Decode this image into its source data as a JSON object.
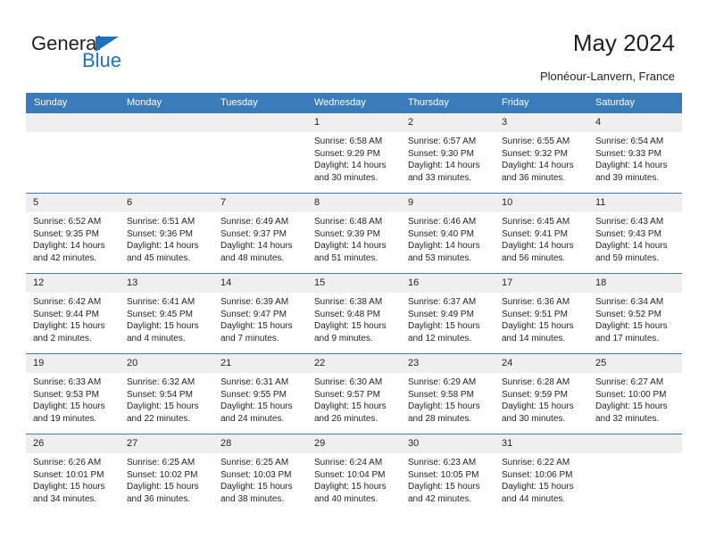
{
  "brand": {
    "name_part1": "General",
    "name_part2": "Blue",
    "color_dark": "#231f20",
    "color_blue": "#1c72bd"
  },
  "header": {
    "title": "May 2024",
    "subtitle": "Plonéour-Lanvern, France"
  },
  "calendar": {
    "header_bg": "#3a7cba",
    "daynum_bg": "#efefef",
    "weekdays": [
      "Sunday",
      "Monday",
      "Tuesday",
      "Wednesday",
      "Thursday",
      "Friday",
      "Saturday"
    ],
    "labels": {
      "sunrise": "Sunrise:",
      "sunset": "Sunset:",
      "daylight": "Daylight:"
    },
    "weeks": [
      [
        {
          "day": "",
          "sunrise": "",
          "sunset": "",
          "daylight_l1": "",
          "daylight_l2": ""
        },
        {
          "day": "",
          "sunrise": "",
          "sunset": "",
          "daylight_l1": "",
          "daylight_l2": ""
        },
        {
          "day": "",
          "sunrise": "",
          "sunset": "",
          "daylight_l1": "",
          "daylight_l2": ""
        },
        {
          "day": "1",
          "sunrise": "Sunrise: 6:58 AM",
          "sunset": "Sunset: 9:29 PM",
          "daylight_l1": "Daylight: 14 hours",
          "daylight_l2": "and 30 minutes."
        },
        {
          "day": "2",
          "sunrise": "Sunrise: 6:57 AM",
          "sunset": "Sunset: 9:30 PM",
          "daylight_l1": "Daylight: 14 hours",
          "daylight_l2": "and 33 minutes."
        },
        {
          "day": "3",
          "sunrise": "Sunrise: 6:55 AM",
          "sunset": "Sunset: 9:32 PM",
          "daylight_l1": "Daylight: 14 hours",
          "daylight_l2": "and 36 minutes."
        },
        {
          "day": "4",
          "sunrise": "Sunrise: 6:54 AM",
          "sunset": "Sunset: 9:33 PM",
          "daylight_l1": "Daylight: 14 hours",
          "daylight_l2": "and 39 minutes."
        }
      ],
      [
        {
          "day": "5",
          "sunrise": "Sunrise: 6:52 AM",
          "sunset": "Sunset: 9:35 PM",
          "daylight_l1": "Daylight: 14 hours",
          "daylight_l2": "and 42 minutes."
        },
        {
          "day": "6",
          "sunrise": "Sunrise: 6:51 AM",
          "sunset": "Sunset: 9:36 PM",
          "daylight_l1": "Daylight: 14 hours",
          "daylight_l2": "and 45 minutes."
        },
        {
          "day": "7",
          "sunrise": "Sunrise: 6:49 AM",
          "sunset": "Sunset: 9:37 PM",
          "daylight_l1": "Daylight: 14 hours",
          "daylight_l2": "and 48 minutes."
        },
        {
          "day": "8",
          "sunrise": "Sunrise: 6:48 AM",
          "sunset": "Sunset: 9:39 PM",
          "daylight_l1": "Daylight: 14 hours",
          "daylight_l2": "and 51 minutes."
        },
        {
          "day": "9",
          "sunrise": "Sunrise: 6:46 AM",
          "sunset": "Sunset: 9:40 PM",
          "daylight_l1": "Daylight: 14 hours",
          "daylight_l2": "and 53 minutes."
        },
        {
          "day": "10",
          "sunrise": "Sunrise: 6:45 AM",
          "sunset": "Sunset: 9:41 PM",
          "daylight_l1": "Daylight: 14 hours",
          "daylight_l2": "and 56 minutes."
        },
        {
          "day": "11",
          "sunrise": "Sunrise: 6:43 AM",
          "sunset": "Sunset: 9:43 PM",
          "daylight_l1": "Daylight: 14 hours",
          "daylight_l2": "and 59 minutes."
        }
      ],
      [
        {
          "day": "12",
          "sunrise": "Sunrise: 6:42 AM",
          "sunset": "Sunset: 9:44 PM",
          "daylight_l1": "Daylight: 15 hours",
          "daylight_l2": "and 2 minutes."
        },
        {
          "day": "13",
          "sunrise": "Sunrise: 6:41 AM",
          "sunset": "Sunset: 9:45 PM",
          "daylight_l1": "Daylight: 15 hours",
          "daylight_l2": "and 4 minutes."
        },
        {
          "day": "14",
          "sunrise": "Sunrise: 6:39 AM",
          "sunset": "Sunset: 9:47 PM",
          "daylight_l1": "Daylight: 15 hours",
          "daylight_l2": "and 7 minutes."
        },
        {
          "day": "15",
          "sunrise": "Sunrise: 6:38 AM",
          "sunset": "Sunset: 9:48 PM",
          "daylight_l1": "Daylight: 15 hours",
          "daylight_l2": "and 9 minutes."
        },
        {
          "day": "16",
          "sunrise": "Sunrise: 6:37 AM",
          "sunset": "Sunset: 9:49 PM",
          "daylight_l1": "Daylight: 15 hours",
          "daylight_l2": "and 12 minutes."
        },
        {
          "day": "17",
          "sunrise": "Sunrise: 6:36 AM",
          "sunset": "Sunset: 9:51 PM",
          "daylight_l1": "Daylight: 15 hours",
          "daylight_l2": "and 14 minutes."
        },
        {
          "day": "18",
          "sunrise": "Sunrise: 6:34 AM",
          "sunset": "Sunset: 9:52 PM",
          "daylight_l1": "Daylight: 15 hours",
          "daylight_l2": "and 17 minutes."
        }
      ],
      [
        {
          "day": "19",
          "sunrise": "Sunrise: 6:33 AM",
          "sunset": "Sunset: 9:53 PM",
          "daylight_l1": "Daylight: 15 hours",
          "daylight_l2": "and 19 minutes."
        },
        {
          "day": "20",
          "sunrise": "Sunrise: 6:32 AM",
          "sunset": "Sunset: 9:54 PM",
          "daylight_l1": "Daylight: 15 hours",
          "daylight_l2": "and 22 minutes."
        },
        {
          "day": "21",
          "sunrise": "Sunrise: 6:31 AM",
          "sunset": "Sunset: 9:55 PM",
          "daylight_l1": "Daylight: 15 hours",
          "daylight_l2": "and 24 minutes."
        },
        {
          "day": "22",
          "sunrise": "Sunrise: 6:30 AM",
          "sunset": "Sunset: 9:57 PM",
          "daylight_l1": "Daylight: 15 hours",
          "daylight_l2": "and 26 minutes."
        },
        {
          "day": "23",
          "sunrise": "Sunrise: 6:29 AM",
          "sunset": "Sunset: 9:58 PM",
          "daylight_l1": "Daylight: 15 hours",
          "daylight_l2": "and 28 minutes."
        },
        {
          "day": "24",
          "sunrise": "Sunrise: 6:28 AM",
          "sunset": "Sunset: 9:59 PM",
          "daylight_l1": "Daylight: 15 hours",
          "daylight_l2": "and 30 minutes."
        },
        {
          "day": "25",
          "sunrise": "Sunrise: 6:27 AM",
          "sunset": "Sunset: 10:00 PM",
          "daylight_l1": "Daylight: 15 hours",
          "daylight_l2": "and 32 minutes."
        }
      ],
      [
        {
          "day": "26",
          "sunrise": "Sunrise: 6:26 AM",
          "sunset": "Sunset: 10:01 PM",
          "daylight_l1": "Daylight: 15 hours",
          "daylight_l2": "and 34 minutes."
        },
        {
          "day": "27",
          "sunrise": "Sunrise: 6:25 AM",
          "sunset": "Sunset: 10:02 PM",
          "daylight_l1": "Daylight: 15 hours",
          "daylight_l2": "and 36 minutes."
        },
        {
          "day": "28",
          "sunrise": "Sunrise: 6:25 AM",
          "sunset": "Sunset: 10:03 PM",
          "daylight_l1": "Daylight: 15 hours",
          "daylight_l2": "and 38 minutes."
        },
        {
          "day": "29",
          "sunrise": "Sunrise: 6:24 AM",
          "sunset": "Sunset: 10:04 PM",
          "daylight_l1": "Daylight: 15 hours",
          "daylight_l2": "and 40 minutes."
        },
        {
          "day": "30",
          "sunrise": "Sunrise: 6:23 AM",
          "sunset": "Sunset: 10:05 PM",
          "daylight_l1": "Daylight: 15 hours",
          "daylight_l2": "and 42 minutes."
        },
        {
          "day": "31",
          "sunrise": "Sunrise: 6:22 AM",
          "sunset": "Sunset: 10:06 PM",
          "daylight_l1": "Daylight: 15 hours",
          "daylight_l2": "and 44 minutes."
        },
        {
          "day": "",
          "sunrise": "",
          "sunset": "",
          "daylight_l1": "",
          "daylight_l2": ""
        }
      ]
    ]
  }
}
